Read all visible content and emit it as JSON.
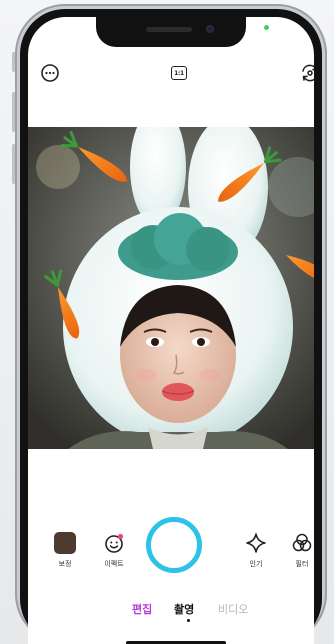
{
  "top_bar": {
    "menu_icon": "more-horizontal-circle-icon",
    "ratio_label": "1:1",
    "flip_icon": "camera-flip-icon"
  },
  "photo": {
    "description_icon": "camera-preview-image"
  },
  "tools": {
    "correction_label": "보정",
    "effect_label": "이펙트",
    "popular_label": "인기",
    "filter_label": "필터",
    "correction_color": "#4c3b2e"
  },
  "modes": {
    "edit_label": "편집",
    "shoot_label": "촬영",
    "video_label": "비디오",
    "active": "촬영"
  },
  "colors": {
    "accent_shutter": "#2ec2e8",
    "edit_purple": "#b63cd8",
    "status_green": "#3bd15c"
  }
}
